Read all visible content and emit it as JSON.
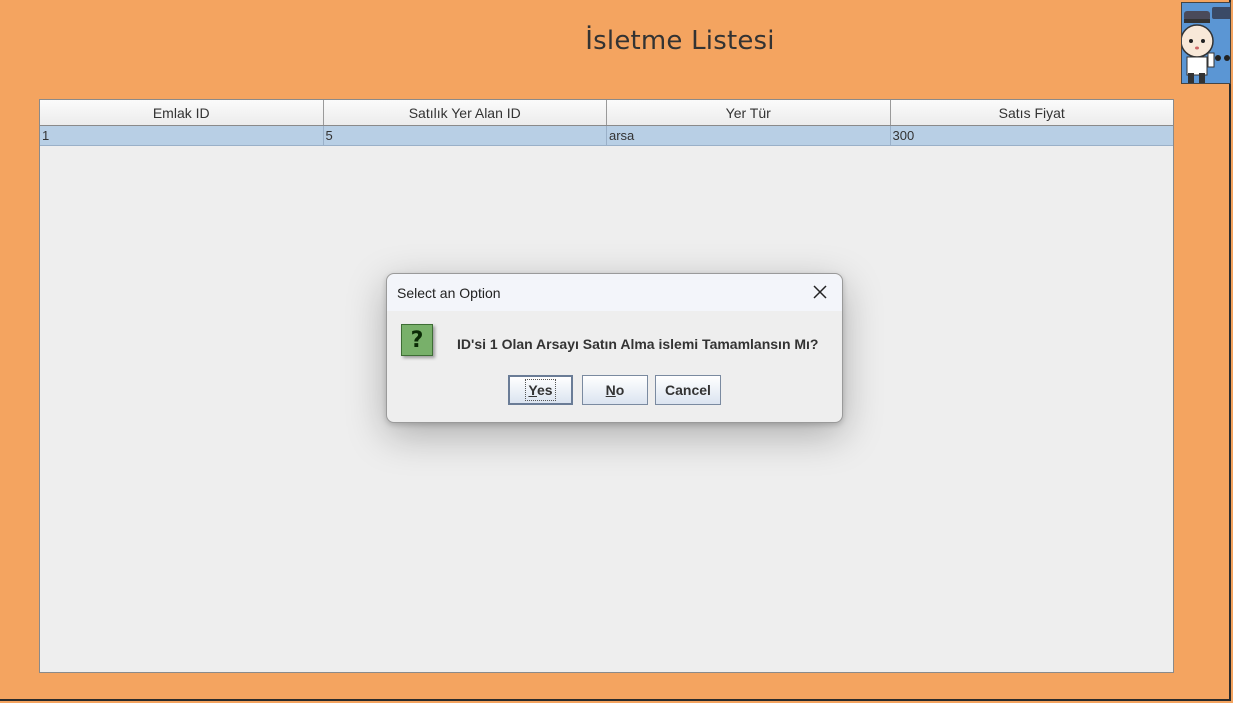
{
  "page": {
    "title": "İsletme Listesi"
  },
  "table": {
    "columns": [
      "Emlak ID",
      "Satılık Yer Alan ID",
      "Yer Tür",
      "Satıs Fiyat"
    ],
    "rows": [
      [
        "1",
        "5",
        "arsa",
        "300"
      ]
    ]
  },
  "dialog": {
    "title": "Select an Option",
    "close_icon": "close-icon",
    "message": "ID'si 1 Olan Arsayı Satın Alma islemi Tamamlansın Mı?",
    "buttons": {
      "yes_mnemonic": "Y",
      "yes_rest": "es",
      "no_mnemonic": "N",
      "no_rest": "o",
      "cancel": "Cancel"
    },
    "icon": "question-icon",
    "icon_glyph": "?"
  },
  "colors": {
    "background": "#f4a460",
    "selected_row": "#b8cfe5",
    "question_icon": "#78b06a"
  }
}
